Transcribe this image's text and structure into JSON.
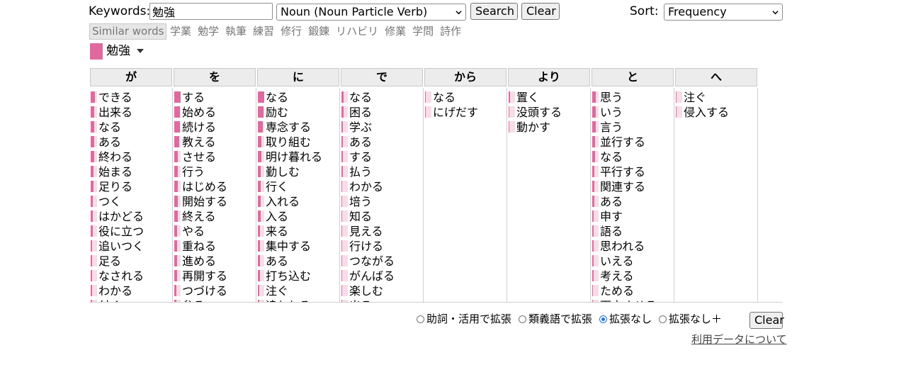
{
  "search": {
    "keywords_label": "Keywords:",
    "keyword_value": "勉強",
    "pos_filter": "Noun (Noun Particle Verb)",
    "search_button": "Search",
    "clear_button": "Clear",
    "sort_label": "Sort:",
    "sort_value": "Frequency"
  },
  "similar": {
    "button": "Similar words",
    "words": [
      "学業",
      "勉学",
      "執筆",
      "練習",
      "修行",
      "鍛錬",
      "リハビリ",
      "修業",
      "学問",
      "詩作"
    ]
  },
  "current_keyword": "勉強",
  "colors": {
    "accent": "#df6a9f",
    "accent_light": "#f7dde8",
    "header_bg": "#ececec",
    "radio_on": "#1a73e8"
  },
  "columns": [
    {
      "particle": "が",
      "items": [
        {
          "word": "できる",
          "level": 0.7
        },
        {
          "word": "出来る",
          "level": 0.6
        },
        {
          "word": "なる",
          "level": 0.6
        },
        {
          "word": "ある",
          "level": 0.5
        },
        {
          "word": "終わる",
          "level": 0.5
        },
        {
          "word": "始まる",
          "level": 0.45
        },
        {
          "word": "足りる",
          "level": 0.4
        },
        {
          "word": "つく",
          "level": 0.35
        },
        {
          "word": "はかどる",
          "level": 0.3
        },
        {
          "word": "役に立つ",
          "level": 0.3
        },
        {
          "word": "追いつく",
          "level": 0.25
        },
        {
          "word": "足る",
          "level": 0.25
        },
        {
          "word": "なされる",
          "level": 0.2
        },
        {
          "word": "わかる",
          "level": 0.2
        },
        {
          "word": "付く",
          "level": 0.2
        }
      ]
    },
    {
      "particle": "を",
      "items": [
        {
          "word": "する",
          "level": 1.0
        },
        {
          "word": "始める",
          "level": 0.9
        },
        {
          "word": "続ける",
          "level": 0.85
        },
        {
          "word": "教える",
          "level": 0.8
        },
        {
          "word": "させる",
          "level": 0.6
        },
        {
          "word": "行う",
          "level": 0.55
        },
        {
          "word": "はじめる",
          "level": 0.55
        },
        {
          "word": "開始する",
          "level": 0.5
        },
        {
          "word": "終える",
          "level": 0.5
        },
        {
          "word": "やる",
          "level": 0.45
        },
        {
          "word": "重ねる",
          "level": 0.45
        },
        {
          "word": "進める",
          "level": 0.4
        },
        {
          "word": "再開する",
          "level": 0.4
        },
        {
          "word": "つづける",
          "level": 0.35
        },
        {
          "word": "怠る",
          "level": 0.35
        }
      ]
    },
    {
      "particle": "に",
      "items": [
        {
          "word": "なる",
          "level": 1.0
        },
        {
          "word": "励む",
          "level": 0.9
        },
        {
          "word": "専念する",
          "level": 0.8
        },
        {
          "word": "取り組む",
          "level": 0.6
        },
        {
          "word": "明け暮れる",
          "level": 0.5
        },
        {
          "word": "勤しむ",
          "level": 0.45
        },
        {
          "word": "行く",
          "level": 0.45
        },
        {
          "word": "入れる",
          "level": 0.4
        },
        {
          "word": "入る",
          "level": 0.4
        },
        {
          "word": "来る",
          "level": 0.35
        },
        {
          "word": "集中する",
          "level": 0.35
        },
        {
          "word": "ある",
          "level": 0.3
        },
        {
          "word": "打ち込む",
          "level": 0.3
        },
        {
          "word": "注ぐ",
          "level": 0.25
        },
        {
          "word": "追われる",
          "level": 0.25
        }
      ]
    },
    {
      "particle": "で",
      "items": [
        {
          "word": "なる",
          "level": 0.35
        },
        {
          "word": "困る",
          "level": 0.3
        },
        {
          "word": "学ぶ",
          "level": 0.25
        },
        {
          "word": "ある",
          "level": 0.2
        },
        {
          "word": "する",
          "level": 0.2
        },
        {
          "word": "払う",
          "level": 0.2
        },
        {
          "word": "わかる",
          "level": 0.15
        },
        {
          "word": "培う",
          "level": 0.15
        },
        {
          "word": "知る",
          "level": 0.15
        },
        {
          "word": "見える",
          "level": 0.1
        },
        {
          "word": "行ける",
          "level": 0.1
        },
        {
          "word": "つながる",
          "level": 0.1
        },
        {
          "word": "がんばる",
          "level": 0.1
        },
        {
          "word": "楽しむ",
          "level": 0.1
        },
        {
          "word": "出る",
          "level": 0.1
        }
      ]
    },
    {
      "particle": "から",
      "items": [
        {
          "word": "なる",
          "level": 0.15
        },
        {
          "word": "にげだす",
          "level": 0.1
        }
      ]
    },
    {
      "particle": "より",
      "items": [
        {
          "word": "置く",
          "level": 0.2
        },
        {
          "word": "没頭する",
          "level": 0.15
        },
        {
          "word": "動かす",
          "level": 0.1
        }
      ]
    },
    {
      "particle": "と",
      "items": [
        {
          "word": "思う",
          "level": 0.6
        },
        {
          "word": "いう",
          "level": 0.55
        },
        {
          "word": "言う",
          "level": 0.5
        },
        {
          "word": "並行する",
          "level": 0.45
        },
        {
          "word": "なる",
          "level": 0.4
        },
        {
          "word": "平行する",
          "level": 0.35
        },
        {
          "word": "関連する",
          "level": 0.3
        },
        {
          "word": "ある",
          "level": 0.3
        },
        {
          "word": "申す",
          "level": 0.25
        },
        {
          "word": "語る",
          "level": 0.25
        },
        {
          "word": "思われる",
          "level": 0.2
        },
        {
          "word": "いえる",
          "level": 0.2
        },
        {
          "word": "考える",
          "level": 0.2
        },
        {
          "word": "ためる",
          "level": 0.15
        },
        {
          "word": "両立させる",
          "level": 0.15
        }
      ]
    },
    {
      "particle": "へ",
      "items": [
        {
          "word": "注ぐ",
          "level": 0.1
        },
        {
          "word": "侵入する",
          "level": 0.1
        }
      ]
    }
  ],
  "options": {
    "items": [
      {
        "label": "助詞・活用で拡張",
        "checked": false
      },
      {
        "label": "類義語で拡張",
        "checked": false
      },
      {
        "label": "拡張なし",
        "checked": true
      },
      {
        "label": "拡張なし＋",
        "checked": false
      }
    ],
    "clear_button": "Clear"
  },
  "footer": {
    "about_link": "利用データについて"
  }
}
